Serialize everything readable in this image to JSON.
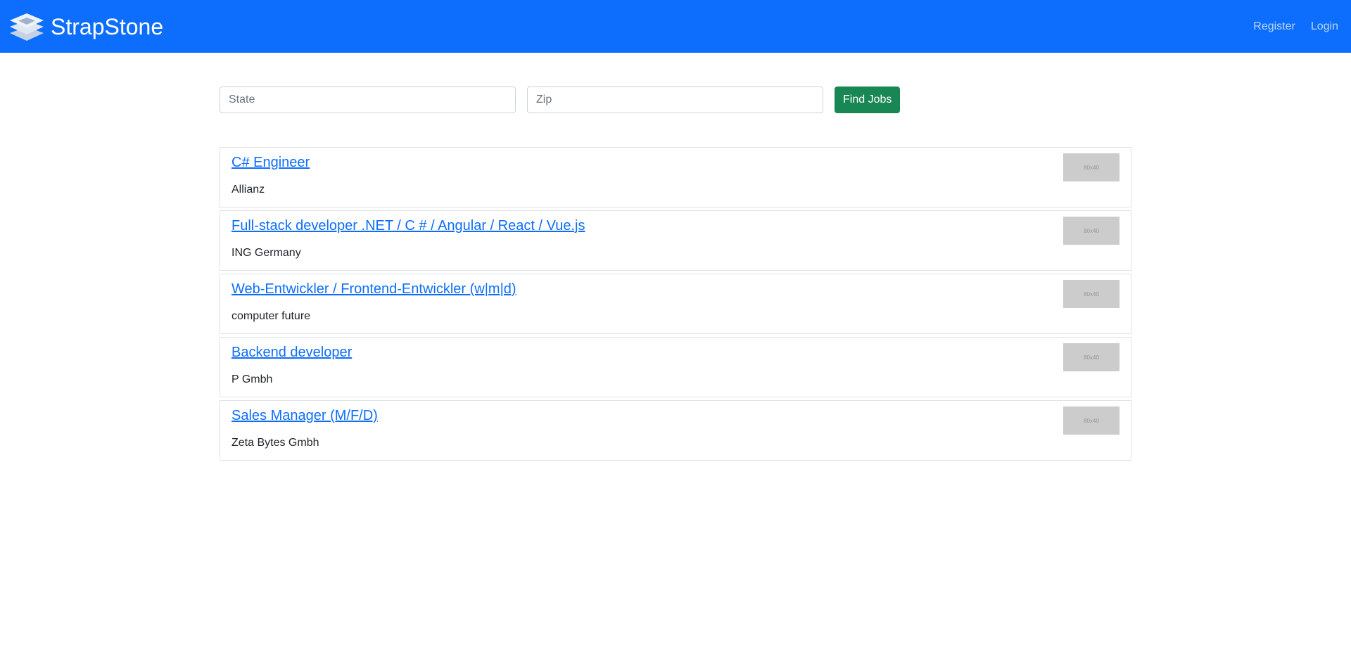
{
  "navbar": {
    "brand": "StrapStone",
    "links": [
      "Register",
      "Login"
    ],
    "color": "#0d6efd"
  },
  "search": {
    "state_placeholder": "State",
    "zip_placeholder": "Zip",
    "button_label": "Find Jobs",
    "button_color": "#198754"
  },
  "jobs": [
    {
      "title": "C# Engineer",
      "company": "Allianz",
      "thumb": "80x40"
    },
    {
      "title": "Full-stack developer .NET / C # / Angular / React / Vue.js",
      "company": "ING Germany",
      "thumb": "80x40"
    },
    {
      "title": "Web-Entwickler / Frontend-Entwickler (w|m|d)",
      "company": "computer future",
      "thumb": "80x40"
    },
    {
      "title": "Backend developer",
      "company": "P Gmbh",
      "thumb": "80x40"
    },
    {
      "title": "Sales Manager (M/F/D)",
      "company": "Zeta Bytes Gmbh",
      "thumb": "80x40"
    }
  ]
}
